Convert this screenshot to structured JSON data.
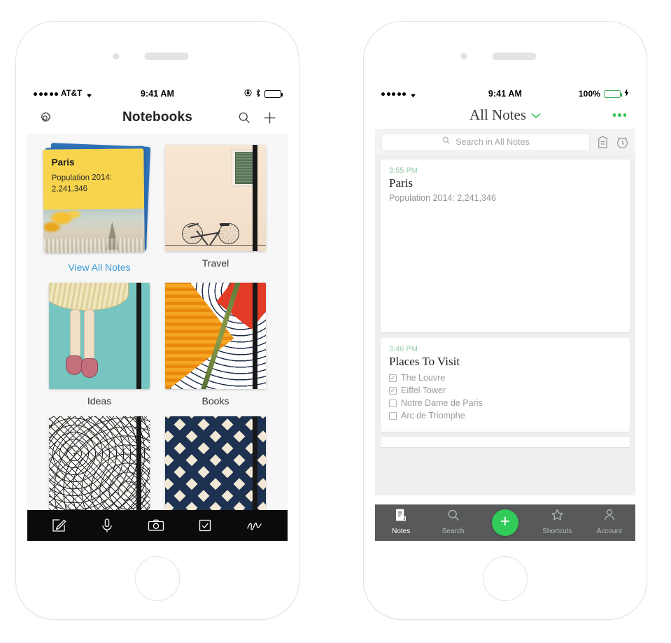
{
  "left_phone": {
    "status_bar": {
      "signal_dots": 5,
      "carrier": "AT&T",
      "wifi_icon": "wifi-icon",
      "time": "9:41 AM",
      "rotation_lock_icon": "rotation-lock-icon",
      "bluetooth_icon": "bluetooth-icon",
      "battery_icon": "battery-icon"
    },
    "nav": {
      "settings_icon": "gear-icon",
      "title": "Notebooks",
      "search_icon": "search-icon",
      "add_icon": "plus-icon"
    },
    "notebooks": [
      {
        "label": "View All Notes",
        "is_link": true,
        "cover": "paris-stack",
        "note": {
          "title": "Paris",
          "line1": "Population 2014:",
          "line2": "2,241,346"
        }
      },
      {
        "label": "Travel",
        "is_link": false,
        "cover": "travel"
      },
      {
        "label": "Ideas",
        "is_link": false,
        "cover": "ideas"
      },
      {
        "label": "Books",
        "is_link": false,
        "cover": "books"
      },
      {
        "label": "",
        "is_link": false,
        "cover": "doodle"
      },
      {
        "label": "",
        "is_link": false,
        "cover": "chevron"
      }
    ],
    "toolbar": [
      {
        "name": "compose-icon"
      },
      {
        "name": "microphone-icon"
      },
      {
        "name": "camera-icon"
      },
      {
        "name": "checkbox-icon"
      },
      {
        "name": "handwriting-icon"
      }
    ]
  },
  "right_phone": {
    "status_bar": {
      "signal_dots": 5,
      "wifi_icon": "wifi-icon",
      "time": "9:41 AM",
      "battery_percent": "100%",
      "charging_icon": "lightning-bolt-icon"
    },
    "nav": {
      "title": "All Notes",
      "chevron_icon": "chevron-down-icon",
      "more_icon": "more-options-icon"
    },
    "search": {
      "placeholder": "Search in All Notes",
      "search_icon": "search-icon",
      "tag_icon": "tag-icon",
      "reminder_icon": "alarm-clock-icon"
    },
    "notes": [
      {
        "time": "3:55 PM",
        "title": "Paris",
        "snippet": "Population 2014: 2,241,346",
        "has_image": true
      },
      {
        "time": "3:46 PM",
        "title": "Places To Visit",
        "checklist": [
          {
            "label": "The Louvre",
            "checked": true
          },
          {
            "label": "Eiffel Tower",
            "checked": true
          },
          {
            "label": "Notre Dame de Paris",
            "checked": false
          },
          {
            "label": "Arc de Triomphe",
            "checked": false
          }
        ]
      }
    ],
    "tabs": [
      {
        "label": "Notes",
        "icon": "notes-icon",
        "active": true
      },
      {
        "label": "Search",
        "icon": "search-icon",
        "active": false
      },
      {
        "label": "",
        "icon": "plus-fab-icon",
        "active": false
      },
      {
        "label": "Shortcuts",
        "icon": "star-icon",
        "active": false
      },
      {
        "label": "Account",
        "icon": "person-icon",
        "active": false
      }
    ],
    "fab_label": "+"
  },
  "colors": {
    "accent_green": "#35c759",
    "link_blue": "#3b9ad9",
    "tabbar_gray": "#57595a",
    "note_yellow": "#f7d44c"
  }
}
